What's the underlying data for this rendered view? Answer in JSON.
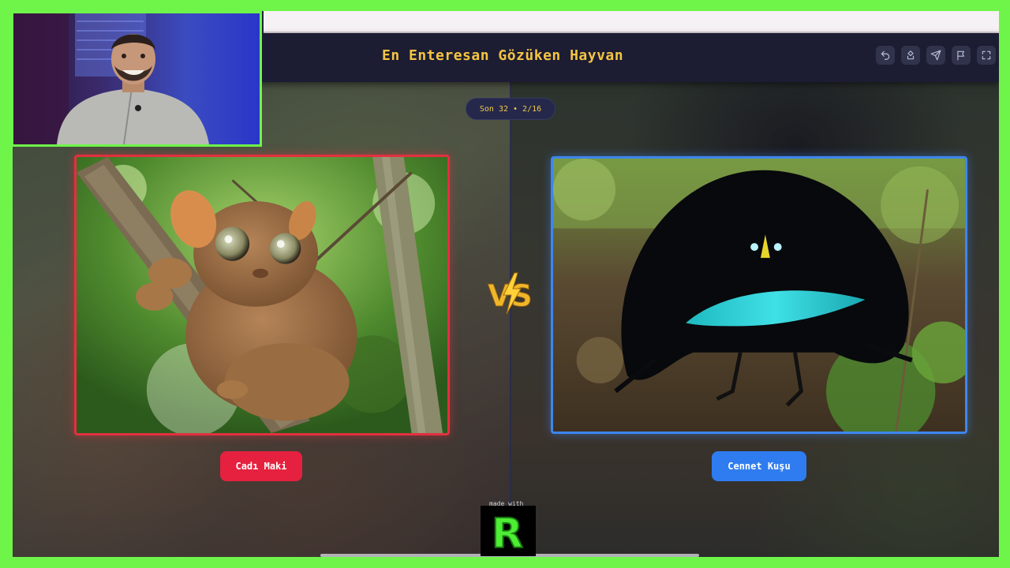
{
  "header": {
    "title": "En Enteresan Gözüken Hayvan"
  },
  "round": {
    "label": "Son 32 • 2/16"
  },
  "left_choice": {
    "label": "Cadı Maki",
    "image_icon": "tarsier-photo"
  },
  "right_choice": {
    "label": "Cennet Kuşu",
    "image_icon": "bird-of-paradise-photo"
  },
  "vs_label": "VS",
  "footer": {
    "made_with": "made with",
    "logo_letter": "R"
  },
  "toolbar_icons": [
    "undo-icon",
    "share-icon",
    "send-icon",
    "flag-icon",
    "fullscreen-icon"
  ],
  "colors": {
    "frame": "#6ff54a",
    "title": "#f4c441",
    "left_accent": "#e5213f",
    "right_accent": "#2f7cf0"
  }
}
